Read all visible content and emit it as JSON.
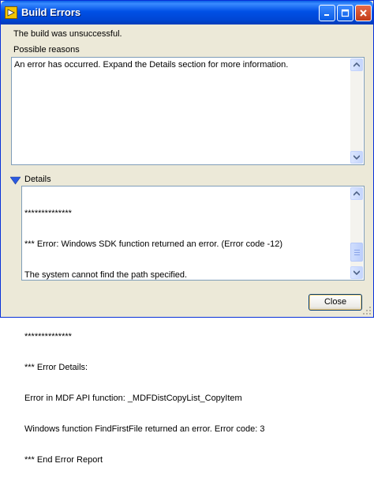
{
  "window": {
    "title": "Build Errors",
    "icon": "labview-app-icon",
    "controls": [
      "minimize-icon",
      "maximize-icon",
      "close-icon"
    ]
  },
  "status_message": "The build was unsuccessful.",
  "reasons": {
    "label": "Possible reasons",
    "text": "An error has occurred. Expand the Details section for more information."
  },
  "details": {
    "label": "Details",
    "expanded": true,
    "lines": [
      "**************",
      "*** Error: Windows SDK function returned an error. (Error code -12)",
      "The system cannot find the path specified.",
      "",
      "**************",
      "*** Error Details:",
      "Error in MDF API function: _MDFDistCopyList_CopyItem",
      "Windows function FindFirstFile returned an error. Error code: 3",
      "*** End Error Report"
    ]
  },
  "close_button": "Close",
  "colors": {
    "titlebar": "#0050e6",
    "window_bg": "#ece9d8",
    "field_border": "#7f9db9",
    "details_arrow": "#2b5ae0"
  }
}
